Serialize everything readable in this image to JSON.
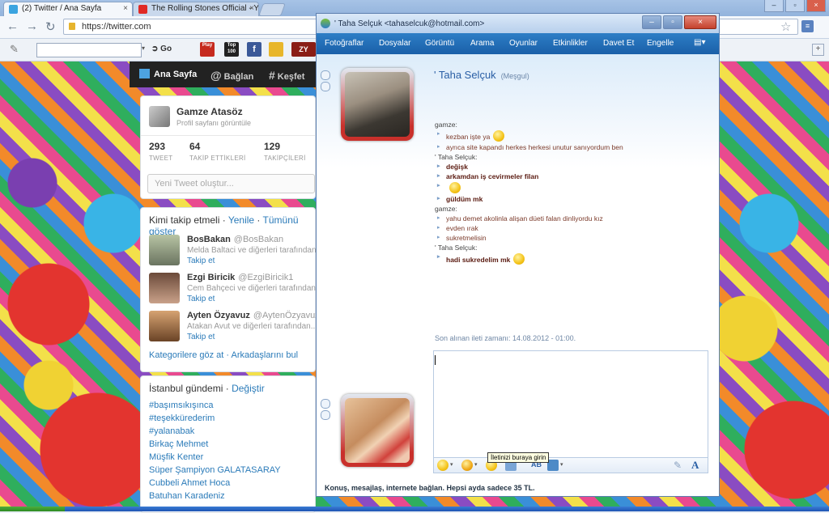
{
  "browser": {
    "tabs": [
      {
        "title": "(2) Twitter / Ana Sayfa",
        "active": true
      },
      {
        "title": "The Rolling Stones Official - Yo",
        "active": false
      }
    ],
    "url": "https://twitter.com",
    "bookmarks": {
      "go_label": "Go",
      "icons": [
        "Play",
        "Top 100",
        "f",
        "ZY"
      ]
    }
  },
  "twitter": {
    "nav": {
      "home": "Ana Sayfa",
      "connect": "Bağlan",
      "discover": "Keşfet"
    },
    "profile": {
      "name": "Gamze Atasöz",
      "subtitle": "Profil sayfanı görüntüle"
    },
    "stats": [
      {
        "value": "293",
        "label": "TWEET"
      },
      {
        "value": "64",
        "label": "TAKİP ETTİKLERİ"
      },
      {
        "value": "129",
        "label": "TAKİPÇİLERİ"
      }
    ],
    "compose_placeholder": "Yeni Tweet oluştur...",
    "who_to_follow": {
      "title": "Kimi takip etmeli",
      "refresh": "Yenile",
      "view_all": "Tümünü göster",
      "users": [
        {
          "name": "BosBakan",
          "handle": "@BosBakan",
          "desc": "Melda Baltaci ve diğerleri tarafından...",
          "follow": "Takip et"
        },
        {
          "name": "Ezgi Biricik",
          "handle": "@EzgiBiricik1",
          "desc": "Cem Bahçeci ve diğerleri tarafından...",
          "follow": "Takip et"
        },
        {
          "name": "Ayten Özyavuz",
          "handle": "@AytenÖzyavuz",
          "desc": "Atakan Avut ve diğerleri tarafından...",
          "follow": "Takip et"
        }
      ],
      "footer": {
        "categories": "Kategorilere göz at",
        "find_friends": "Arkadaşlarını bul"
      }
    },
    "trends": {
      "title": "İstanbul gündemi",
      "change": "Değiştir",
      "items": [
        "#başımsıkışınca",
        "#teşekkürederim",
        "#yalanabak",
        "Birkaç Mehmet",
        "Müşfik Kenter",
        "Süper Şampiyon GALATASARAY",
        "Cubbeli Ahmet Hoca",
        "Batuhan Karadeniz"
      ]
    }
  },
  "messenger": {
    "title": "' Taha Selçuk <tahaselcuk@hotmail.com>",
    "menu": [
      "Fotoğraflar",
      "Dosyalar",
      "Görüntü",
      "Arama",
      "Oyunlar",
      "Etkinlikler",
      "Davet Et",
      "Engelle"
    ],
    "contact_name": "' Taha Selçuk",
    "contact_status": "(Meşgul)",
    "conversation": [
      {
        "kind": "sender",
        "text": "gamze:"
      },
      {
        "kind": "msg",
        "text": "kezban işte ya",
        "smiley": true
      },
      {
        "kind": "msg",
        "text": "ayrıca site kapandı herkes herkesi unutur sanıyordum ben"
      },
      {
        "kind": "sender",
        "text": "' Taha Selçuk:"
      },
      {
        "kind": "msg-b",
        "text": "değişk"
      },
      {
        "kind": "msg-b",
        "text": "arkamdan iş cevirmeler filan"
      },
      {
        "kind": "msg-b",
        "text": "",
        "smiley": true
      },
      {
        "kind": "msg-b",
        "text": "güldüm mk"
      },
      {
        "kind": "sender",
        "text": "gamze:"
      },
      {
        "kind": "msg",
        "text": "yahu demet akolinla alişan düeti falan dinliyordu kız"
      },
      {
        "kind": "msg",
        "text": "evden ırak"
      },
      {
        "kind": "msg",
        "text": "sukretmelisin"
      },
      {
        "kind": "sender",
        "text": "' Taha Selçuk:"
      },
      {
        "kind": "msg-b",
        "text": "hadi sukredelim mk",
        "smiley": true
      }
    ],
    "last_message": "Son alınan ileti zamanı: 14.08.2012 - 01:00.",
    "input_tooltip": "İletinizi buraya girin",
    "footer_ad": "Konuş, mesajlaş, internete bağlan. Hepsi ayda sadece 35 TL."
  }
}
